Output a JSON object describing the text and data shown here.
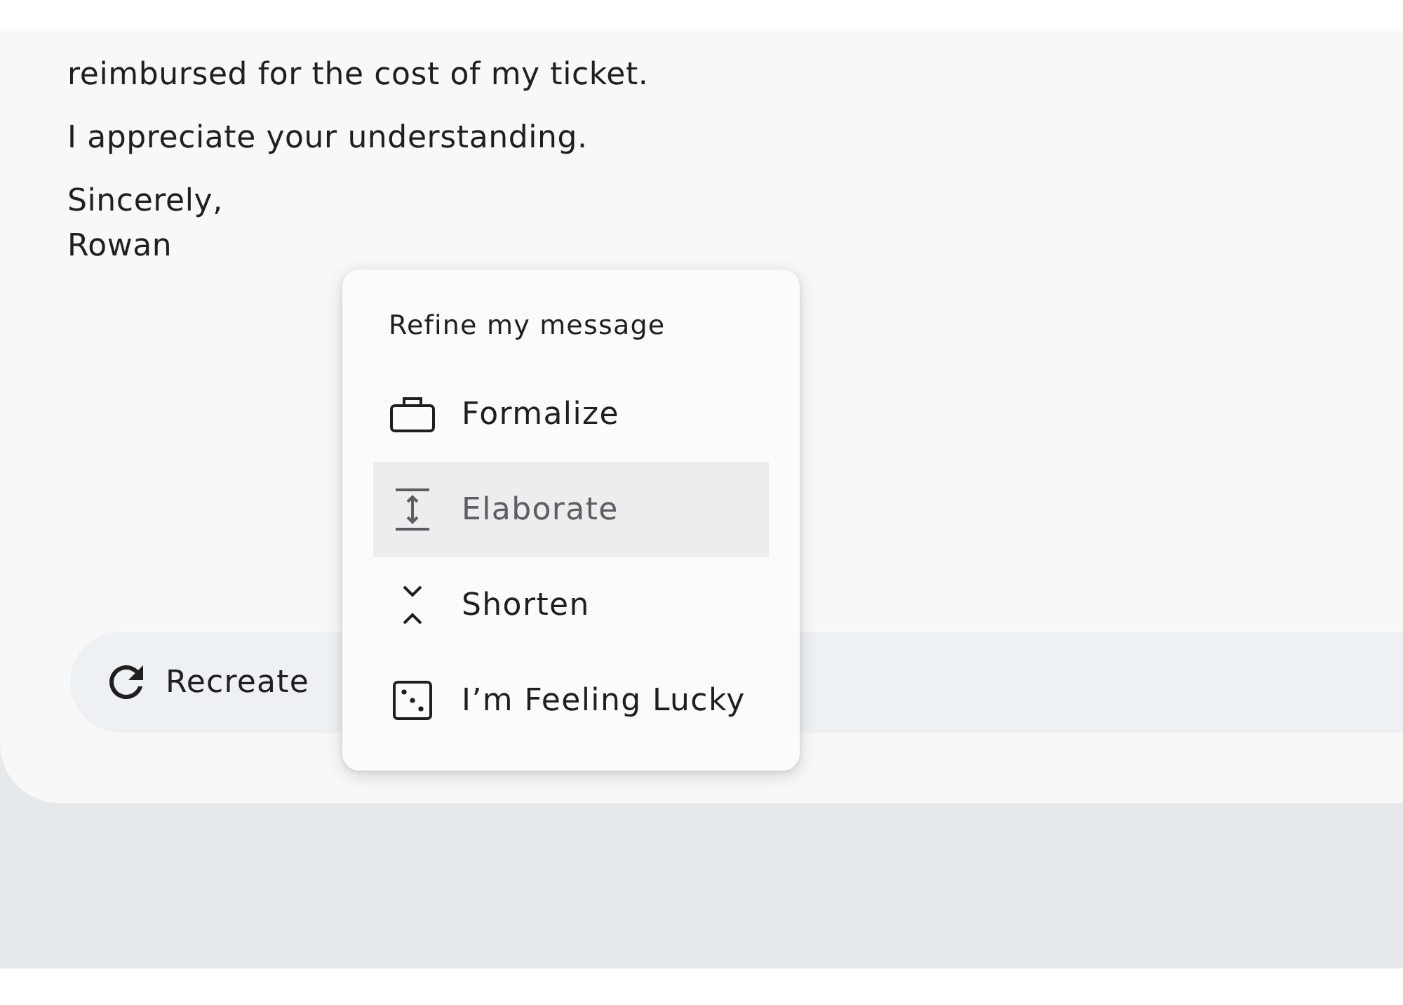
{
  "letter": {
    "paragraphs": [
      [
        "reimbursed for the cost of my ticket."
      ],
      [
        "I appreciate your understanding."
      ],
      [
        "Sincerely,",
        "Rowan"
      ]
    ]
  },
  "recreate_button": {
    "label": "Recreate"
  },
  "refine_menu": {
    "title": "Refine my message",
    "items": [
      {
        "label": "Formalize",
        "selected": false
      },
      {
        "label": "Elaborate",
        "selected": true
      },
      {
        "label": "Shorten",
        "selected": false
      },
      {
        "label": "I’m Feeling Lucky",
        "selected": false
      }
    ]
  }
}
